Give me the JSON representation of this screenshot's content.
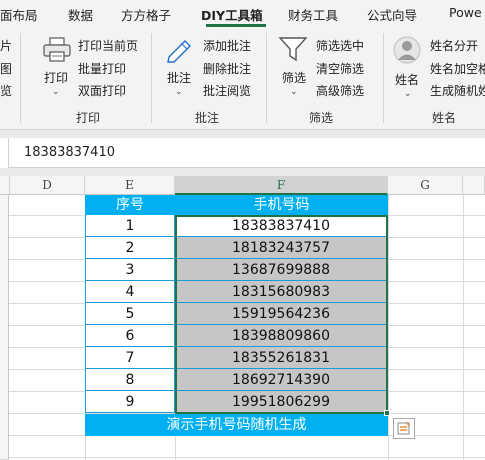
{
  "ribbon": {
    "tabs": [
      {
        "label": "面布局"
      },
      {
        "label": "数据"
      },
      {
        "label": "方方格子"
      },
      {
        "label": "DIY工具箱"
      },
      {
        "label": "财务工具"
      },
      {
        "label": "公式向导"
      },
      {
        "label": "Powe"
      }
    ],
    "left_partial": {
      "line1": "片",
      "line2": "图",
      "line3": "览"
    },
    "print_group": {
      "big_button": "打印",
      "items": [
        "打印当前页",
        "批量打印",
        "双面打印"
      ],
      "label": "打印"
    },
    "comment_group": {
      "big_button": "批注",
      "items": [
        "添加批注",
        "删除批注",
        "批注阅览"
      ],
      "label": "批注"
    },
    "filter_group": {
      "big_button": "筛选",
      "items": [
        "筛选选中",
        "清空筛选",
        "高级筛选"
      ],
      "label": "筛选"
    },
    "name_group": {
      "big_button": "姓名",
      "items": [
        "姓名分开",
        "姓名加空格",
        "生成随机姓"
      ],
      "label": "姓名"
    }
  },
  "formula_bar": {
    "value": "18383837410"
  },
  "columns": [
    "D",
    "E",
    "F",
    "G"
  ],
  "table": {
    "headers": {
      "seq": "序号",
      "phone": "手机号码"
    },
    "rows": [
      {
        "seq": "1",
        "phone": "18383837410"
      },
      {
        "seq": "2",
        "phone": "18183243757"
      },
      {
        "seq": "3",
        "phone": "13687699888"
      },
      {
        "seq": "4",
        "phone": "18315680983"
      },
      {
        "seq": "5",
        "phone": "15919564236"
      },
      {
        "seq": "6",
        "phone": "18398809860"
      },
      {
        "seq": "7",
        "phone": "18355261831"
      },
      {
        "seq": "8",
        "phone": "18692714390"
      },
      {
        "seq": "9",
        "phone": "19951806299"
      }
    ],
    "banner": "演示手机号码随机生成"
  },
  "colors": {
    "accent": "#217346",
    "header_fill": "#00b0f0",
    "selection_fill": "#c6c6c6"
  }
}
